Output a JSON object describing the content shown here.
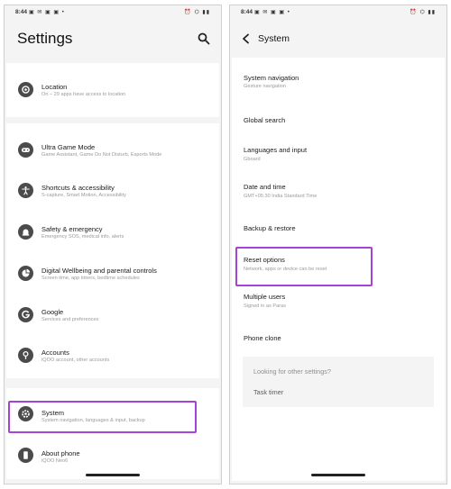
{
  "status_bar": {
    "time": "8:44",
    "left_icons": "▣ ✉ ▣ ▣ •",
    "right_icons": "⏰ ⌬ ▮▮"
  },
  "left_screen": {
    "title": "Settings",
    "items": [
      {
        "title": "Location",
        "subtitle": "On – 29 apps have access to location",
        "icon": "location-icon"
      },
      {
        "title": "Ultra Game Mode",
        "subtitle": "Game Assistant, Game Do Not Disturb, Esports Mode",
        "icon": "gamepad-icon"
      },
      {
        "title": "Shortcuts & accessibility",
        "subtitle": "S-capture, Smart Motion, Accessibility",
        "icon": "accessibility-icon"
      },
      {
        "title": "Safety & emergency",
        "subtitle": "Emergency SOS, medical info, alerts",
        "icon": "emergency-icon"
      },
      {
        "title": "Digital Wellbeing and parental controls",
        "subtitle": "Screen time, app timers, bedtime schedules",
        "icon": "wellbeing-icon"
      },
      {
        "title": "Google",
        "subtitle": "Services and preferences",
        "icon": "google-icon"
      },
      {
        "title": "Accounts",
        "subtitle": "iQOO account, other accounts",
        "icon": "account-icon"
      },
      {
        "title": "System",
        "subtitle": "System navigation, languages & input, backup",
        "icon": "gear-icon"
      },
      {
        "title": "About phone",
        "subtitle": "iQOO Neo6",
        "icon": "phone-icon"
      }
    ]
  },
  "right_screen": {
    "title": "System",
    "items": [
      {
        "title": "System navigation",
        "subtitle": "Gesture navigation"
      },
      {
        "title": "Global search",
        "subtitle": ""
      },
      {
        "title": "Languages and input",
        "subtitle": "Gboard"
      },
      {
        "title": "Date and time",
        "subtitle": "GMT+05:30 India Standard Time"
      },
      {
        "title": "Backup & restore",
        "subtitle": ""
      },
      {
        "title": "Reset options",
        "subtitle": "Network, apps or device can be reset"
      },
      {
        "title": "Multiple users",
        "subtitle": "Signed in as Paras"
      },
      {
        "title": "Phone clone",
        "subtitle": ""
      }
    ],
    "other_settings": {
      "heading": "Looking for other settings?",
      "link": "Task timer"
    }
  },
  "colors": {
    "highlight": "#a543d6",
    "background": "#f4f4f4",
    "card": "#ffffff",
    "icon_fill": "#4b4b4b"
  }
}
